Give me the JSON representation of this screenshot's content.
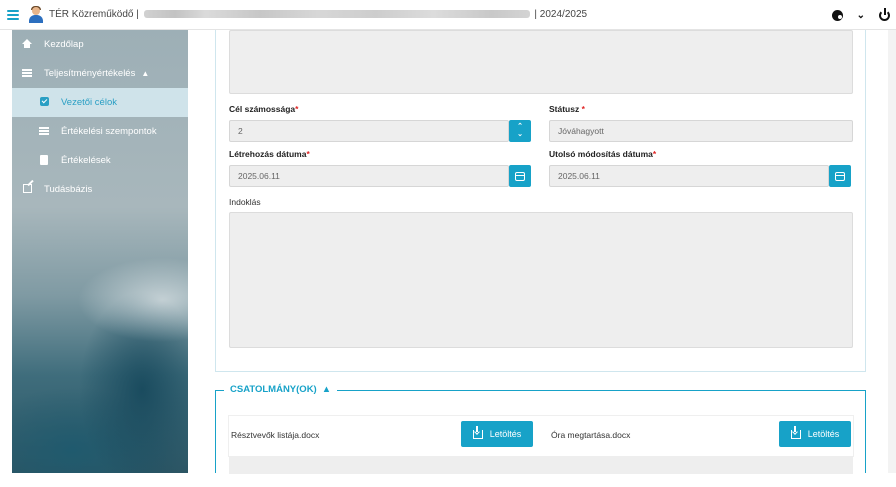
{
  "header": {
    "title_prefix": "TÉR Közreműködő |",
    "title_suffix": "| 2024/2025"
  },
  "sidebar": {
    "items": [
      {
        "label": "Kezdőlap",
        "icon": "home-icon"
      },
      {
        "label": "Teljesítményértékelés",
        "icon": "list-icon",
        "expanded": true
      },
      {
        "label": "Vezetői célok",
        "icon": "check-square-icon",
        "active": true
      },
      {
        "label": "Értékelési szempontok",
        "icon": "list-icon"
      },
      {
        "label": "Értékelések",
        "icon": "document-icon"
      },
      {
        "label": "Tudásbázis",
        "icon": "edit-icon"
      }
    ]
  },
  "form": {
    "goal_count_label": "Cél számossága",
    "goal_count_value": "2",
    "status_label": "Státusz",
    "status_value": "Jóváhagyott",
    "created_label": "Létrehozás dátuma",
    "created_value": "2025.06.11",
    "modified_label": "Utolsó módosítás dátuma",
    "modified_value": "2025.06.11",
    "reason_label": "Indoklás",
    "required_mark": "*"
  },
  "attachments": {
    "legend": "CSATOLMÁNY(OK)",
    "files": [
      {
        "name": "Résztvevők listája.docx",
        "button": "Letöltés"
      },
      {
        "name": "Óra megtartása.docx",
        "button": "Letöltés"
      }
    ]
  },
  "colors": {
    "accent": "#17a2c8",
    "required": "#e02424",
    "field_bg": "#eeeeee"
  }
}
